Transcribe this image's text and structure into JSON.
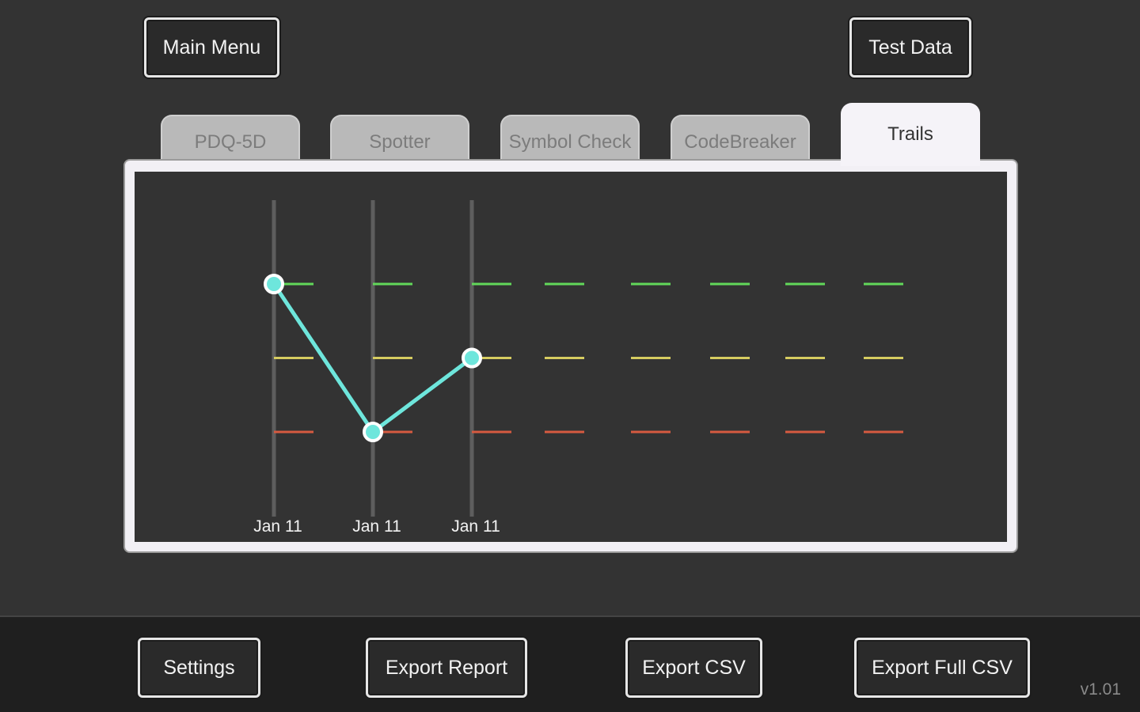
{
  "header": {
    "main_menu_label": "Main Menu",
    "test_data_label": "Test Data"
  },
  "tabs": [
    {
      "label": "PDQ-5D",
      "active": false
    },
    {
      "label": "Spotter",
      "active": false
    },
    {
      "label": "Symbol Check",
      "active": false
    },
    {
      "label": "CodeBreaker",
      "active": false
    },
    {
      "label": "Trails",
      "active": true
    }
  ],
  "chart_data": {
    "type": "line",
    "x_labels": [
      "Jan 11",
      "Jan 11",
      "Jan 11"
    ],
    "series": [
      {
        "values": [
          3,
          1,
          2
        ],
        "color": "#6ee6dc"
      }
    ],
    "ylim": [
      1,
      3
    ],
    "reference_levels": [
      {
        "value": 3,
        "color": "#62d85a"
      },
      {
        "value": 2,
        "color": "#d6cc60"
      },
      {
        "value": 1,
        "color": "#d65a40"
      }
    ],
    "grid": "vertical lines at each test date"
  },
  "footer": {
    "settings_label": "Settings",
    "export_report_label": "Export Report",
    "export_csv_label": "Export CSV",
    "export_full_csv_label": "Export Full CSV",
    "version": "v1.01"
  },
  "colors": {
    "background": "#333333",
    "footer_background": "#1f1f1f",
    "panel_frame": "#f2f0f5",
    "trend_line": "#6ee6dc"
  }
}
